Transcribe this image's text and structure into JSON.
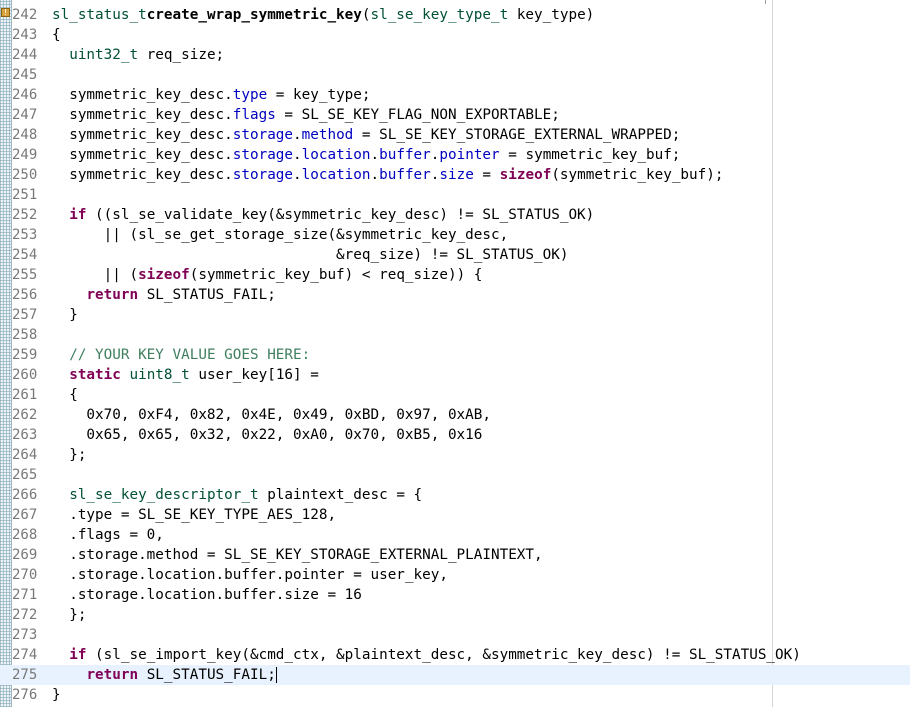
{
  "editor": {
    "current_line": 275,
    "lines": [
      {
        "no": "242",
        "fold": "",
        "segs": [
          [
            "ty",
            "sl_status_t"
          ],
          [
            "",
            "",
            " "
          ],
          [
            "fn",
            "create_wrap_symmetric_key"
          ],
          [
            "",
            "(",
            ""
          ],
          [
            "ty",
            "sl_se_key_type_t"
          ],
          [
            "",
            " key_type)"
          ]
        ]
      },
      {
        "no": "243",
        "segs": [
          [
            "",
            "{"
          ]
        ]
      },
      {
        "no": "244",
        "segs": [
          [
            "",
            "  "
          ],
          [
            "ty",
            "uint32_t"
          ],
          [
            "",
            " req_size;"
          ]
        ]
      },
      {
        "no": "245",
        "segs": []
      },
      {
        "no": "246",
        "segs": [
          [
            "",
            "  symmetric_key_desc."
          ],
          [
            "fld",
            "type"
          ],
          [
            "",
            " = key_type;"
          ]
        ]
      },
      {
        "no": "247",
        "segs": [
          [
            "",
            "  symmetric_key_desc."
          ],
          [
            "fld",
            "flags"
          ],
          [
            "",
            " = SL_SE_KEY_FLAG_NON_EXPORTABLE;"
          ]
        ]
      },
      {
        "no": "248",
        "segs": [
          [
            "",
            "  symmetric_key_desc."
          ],
          [
            "fld",
            "storage"
          ],
          [
            "",
            "."
          ],
          [
            "fld",
            "method"
          ],
          [
            "",
            " = SL_SE_KEY_STORAGE_EXTERNAL_WRAPPED;"
          ]
        ]
      },
      {
        "no": "249",
        "segs": [
          [
            "",
            "  symmetric_key_desc."
          ],
          [
            "fld",
            "storage"
          ],
          [
            "",
            "."
          ],
          [
            "fld",
            "location"
          ],
          [
            "",
            "."
          ],
          [
            "fld",
            "buffer"
          ],
          [
            "",
            "."
          ],
          [
            "fld",
            "pointer"
          ],
          [
            "",
            " = symmetric_key_buf;"
          ]
        ]
      },
      {
        "no": "250",
        "segs": [
          [
            "",
            "  symmetric_key_desc."
          ],
          [
            "fld",
            "storage"
          ],
          [
            "",
            "."
          ],
          [
            "fld",
            "location"
          ],
          [
            "",
            "."
          ],
          [
            "fld",
            "buffer"
          ],
          [
            "",
            "."
          ],
          [
            "fld",
            "size"
          ],
          [
            "",
            " = "
          ],
          [
            "kw",
            "sizeof"
          ],
          [
            "",
            "(symmetric_key_buf);"
          ]
        ]
      },
      {
        "no": "251",
        "segs": []
      },
      {
        "no": "252",
        "segs": [
          [
            "",
            "  "
          ],
          [
            "kw",
            "if"
          ],
          [
            "",
            " ((sl_se_validate_key(&symmetric_key_desc) != SL_STATUS_OK)"
          ]
        ]
      },
      {
        "no": "253",
        "segs": [
          [
            "",
            "      || (sl_se_get_storage_size(&symmetric_key_desc,"
          ]
        ]
      },
      {
        "no": "254",
        "segs": [
          [
            "",
            "                                 &req_size) != SL_STATUS_OK)"
          ]
        ]
      },
      {
        "no": "255",
        "segs": [
          [
            "",
            "      || ("
          ],
          [
            "kw",
            "sizeof"
          ],
          [
            "",
            "(symmetric_key_buf) < req_size)) {"
          ]
        ]
      },
      {
        "no": "256",
        "segs": [
          [
            "",
            "    "
          ],
          [
            "kw",
            "return"
          ],
          [
            "",
            " SL_STATUS_FAIL;"
          ]
        ]
      },
      {
        "no": "257",
        "segs": [
          [
            "",
            "  }"
          ]
        ]
      },
      {
        "no": "258",
        "segs": []
      },
      {
        "no": "259",
        "segs": [
          [
            "",
            "  "
          ],
          [
            "cm",
            "// YOUR KEY VALUE GOES HERE:"
          ]
        ]
      },
      {
        "no": "260",
        "segs": [
          [
            "",
            "  "
          ],
          [
            "kw",
            "static"
          ],
          [
            "",
            " "
          ],
          [
            "ty",
            "uint8_t"
          ],
          [
            "",
            " user_key[16] ="
          ]
        ]
      },
      {
        "no": "261",
        "segs": [
          [
            "",
            "  {"
          ]
        ]
      },
      {
        "no": "262",
        "segs": [
          [
            "",
            "    0x70, 0xF4, 0x82, 0x4E, 0x49, 0xBD, 0x97, 0xAB,"
          ]
        ]
      },
      {
        "no": "263",
        "segs": [
          [
            "",
            "    0x65, 0x65, 0x32, 0x22, 0xA0, 0x70, 0xB5, 0x16"
          ]
        ]
      },
      {
        "no": "264",
        "segs": [
          [
            "",
            "  };"
          ]
        ]
      },
      {
        "no": "265",
        "segs": []
      },
      {
        "no": "266",
        "segs": [
          [
            "",
            "  "
          ],
          [
            "ty",
            "sl_se_key_descriptor_t"
          ],
          [
            "",
            " plaintext_desc = {"
          ]
        ]
      },
      {
        "no": "267",
        "segs": [
          [
            "",
            "  .type = SL_SE_KEY_TYPE_AES_128,"
          ]
        ]
      },
      {
        "no": "268",
        "segs": [
          [
            "",
            "  .flags = 0,"
          ]
        ]
      },
      {
        "no": "269",
        "segs": [
          [
            "",
            "  .storage.method = SL_SE_KEY_STORAGE_EXTERNAL_PLAINTEXT,"
          ]
        ]
      },
      {
        "no": "270",
        "segs": [
          [
            "",
            "  .storage.location.buffer.pointer = user_key,"
          ]
        ]
      },
      {
        "no": "271",
        "segs": [
          [
            "",
            "  .storage.location.buffer.size = 16"
          ]
        ]
      },
      {
        "no": "272",
        "segs": [
          [
            "",
            "  };"
          ]
        ]
      },
      {
        "no": "273",
        "segs": []
      },
      {
        "no": "274",
        "segs": [
          [
            "",
            "  "
          ],
          [
            "kw",
            "if"
          ],
          [
            "",
            " (sl_se_import_key(&cmd_ctx, &plaintext_desc, &symmetric_key_desc) != SL_STATUS_OK)"
          ]
        ]
      },
      {
        "no": "275",
        "segs": [
          [
            "",
            "    "
          ],
          [
            "kw",
            "return"
          ],
          [
            "",
            " SL_STATUS_FAIL;"
          ]
        ],
        "caret": true
      },
      {
        "no": "276",
        "segs": [
          [
            "",
            "}"
          ]
        ]
      }
    ]
  },
  "colors": {
    "keyword": "#7f0055",
    "type": "#005032",
    "field": "#0000c0",
    "comment": "#3f7f5f",
    "current_line_bg": "#e8f2fe"
  },
  "icons": {
    "fold_marker": "warning-marker-icon",
    "fold_toggle": "collapse-icon"
  }
}
